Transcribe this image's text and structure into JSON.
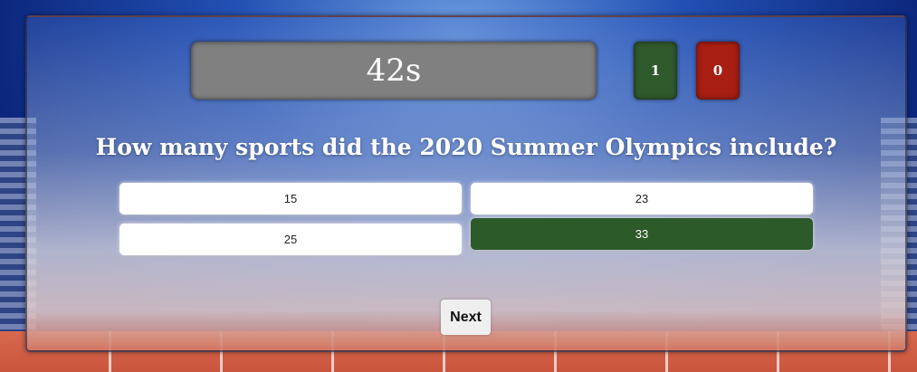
{
  "timer": {
    "text": "42s"
  },
  "score": {
    "correct": "1",
    "wrong": "0"
  },
  "question": {
    "text": "How many sports did the 2020 Summer Olympics include?"
  },
  "answers": [
    {
      "label": "15",
      "state": "default"
    },
    {
      "label": "23",
      "state": "default"
    },
    {
      "label": "25",
      "state": "default"
    },
    {
      "label": "33",
      "state": "correct"
    }
  ],
  "next_button": {
    "label": "Next"
  },
  "colors": {
    "correct": "#2d5a29",
    "wrong": "#a81e12",
    "timer_bg": "#808080"
  }
}
